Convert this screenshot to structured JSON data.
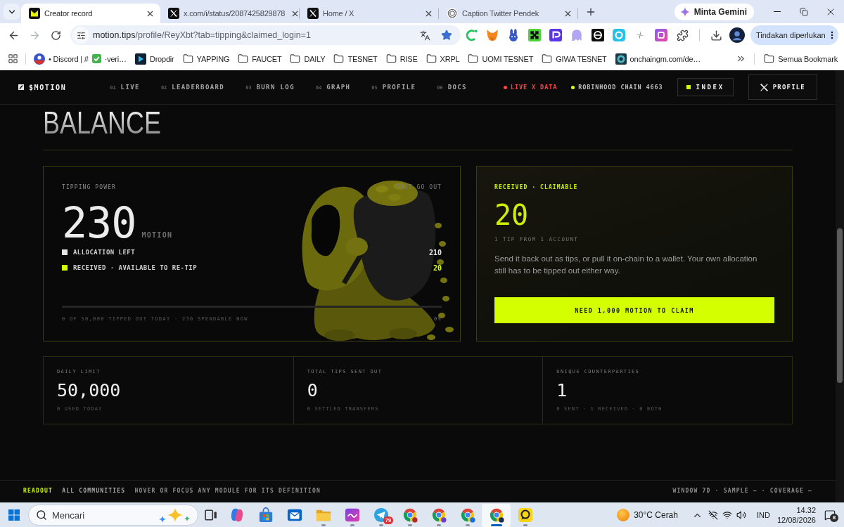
{
  "browser": {
    "tabs": [
      {
        "title": "Creator record",
        "selected": true
      },
      {
        "title": "x.com/i/status/2087425829878",
        "selected": false
      },
      {
        "title": "Home / X",
        "selected": false
      },
      {
        "title": "Caption Twitter Pendek",
        "selected": false
      }
    ],
    "gemini_button": "Minta Gemini",
    "navigation": {
      "forward_disabled": true
    },
    "address_bar": {
      "url": "motion.tips/profile/ReyXbt?tab=tipping&claimed_login=1",
      "bookmarked": true
    },
    "action_button": "Tindakan diperlukan",
    "bookmarks": [
      {
        "kind": "site",
        "label": "• Discord | #",
        "label_end": "·veri…"
      },
      {
        "kind": "site",
        "label": "Dropdir"
      },
      {
        "kind": "folder",
        "label": "YAPPING"
      },
      {
        "kind": "folder",
        "label": "FAUCET"
      },
      {
        "kind": "folder",
        "label": "DAILY"
      },
      {
        "kind": "folder",
        "label": "TESNET"
      },
      {
        "kind": "folder",
        "label": "RISE"
      },
      {
        "kind": "folder",
        "label": "XRPL"
      },
      {
        "kind": "folder",
        "label": "UOMI TESNET"
      },
      {
        "kind": "folder",
        "label": "GIWA TESNET"
      },
      {
        "kind": "site",
        "label": "onchaingm.com/de…"
      }
    ],
    "all_bookmarks": "Semua Bookmark"
  },
  "site": {
    "nav": {
      "logo": "$MOTION",
      "links": [
        {
          "number": "01",
          "label": "LIVE",
          "selected": false
        },
        {
          "number": "02",
          "label": "LEADERBOARD",
          "selected": false
        },
        {
          "number": "03",
          "label": "BURN LOG",
          "selected": false
        },
        {
          "number": "04",
          "label": "GRAPH",
          "selected": false
        },
        {
          "number": "05",
          "label": "PROFILE",
          "selected": false
        },
        {
          "number": "06",
          "label": "DOCS",
          "selected": false
        }
      ],
      "statuses": [
        {
          "kind": "live",
          "label": "LIVE X DATA",
          "color": "#ff4141"
        },
        {
          "kind": "network",
          "label": "ROBINHOOD CHAIN 4663",
          "color": "#e2ff1c"
        }
      ],
      "index_button": "INDEX",
      "profile_button": "PROFILE"
    },
    "heading": "BALANCE",
    "tipping_power": {
      "label": "TIPPING POWER",
      "note": "MUST GO OUT",
      "amount": "230",
      "unit": "MOTION",
      "breakdown": [
        {
          "label": "ALLOCATION LEFT",
          "value": "210",
          "color": "#e6e6e6"
        },
        {
          "label": "RECEIVED · AVAILABLE TO RE-TIP",
          "value": "20",
          "color": "#d4ff00"
        }
      ],
      "progress": {
        "level": 0,
        "caption": "0 OF 50,000 TIPPED OUT TODAY · 230 SPENDABLE NOW",
        "reading": "0%"
      }
    },
    "claimable": {
      "label": "RECEIVED · CLAIMABLE",
      "amount": "20",
      "detail": "1 TIP FROM 1 ACCOUNT",
      "description": "Send it back out as tips, or pull it on-chain to a wallet. Your own allocation still has to be tipped out either way.",
      "claim_button": "NEED 1,000 MOTION TO CLAIM"
    },
    "stats": [
      {
        "label": "DAILY LIMIT",
        "value": "50,000",
        "detail": "0 USED TODAY"
      },
      {
        "label": "TOTAL TIPS SENT OUT",
        "value": "0",
        "detail": "0 SETTLED TRANSFERS"
      },
      {
        "label": "UNIQUE COUNTERPARTIES",
        "value": "1",
        "detail": "0 SENT · 1 RECEIVED · 0 BOTH"
      }
    ],
    "readout": {
      "title": "READOUT",
      "scope": "ALL COMMUNITIES",
      "hint": "HOVER OR FOCUS ANY MODULE FOR ITS DEFINITION",
      "meta": "WINDOW 7D · SAMPLE — · COVERAGE —"
    }
  },
  "taskbar": {
    "search": {
      "placeholder": "Mencari"
    },
    "apps": [
      {
        "running": false,
        "selected": false
      },
      {
        "running": false,
        "selected": false
      },
      {
        "running": false,
        "selected": false
      },
      {
        "running": true,
        "selected": false
      },
      {
        "running": true,
        "selected": false
      },
      {
        "running": true,
        "selected": false,
        "badge": "79"
      },
      {
        "running": true,
        "selected": false
      },
      {
        "running": true,
        "selected": false
      },
      {
        "running": true,
        "selected": false
      },
      {
        "running": true,
        "selected": true
      },
      {
        "running": true,
        "selected": false
      }
    ],
    "weather": "30°C Cerah",
    "language": "IND",
    "time": "14.32",
    "date": "12/08/2026",
    "notifications": "8"
  }
}
